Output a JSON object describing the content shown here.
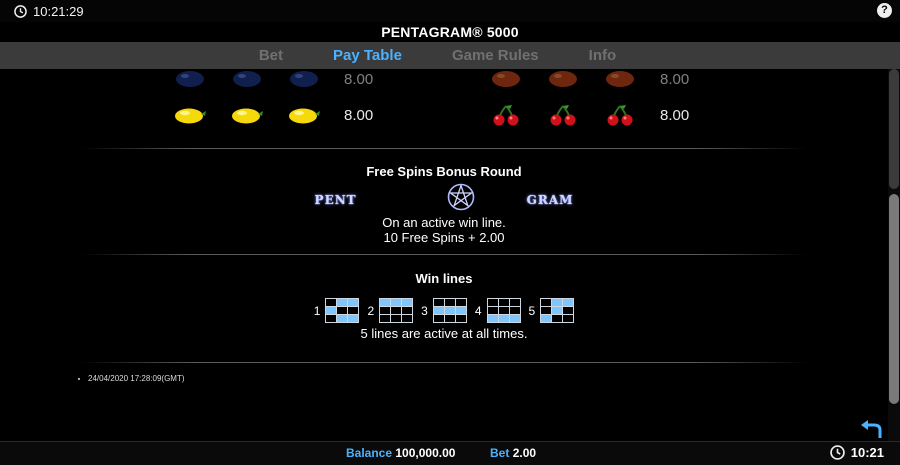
{
  "status_bar": {
    "time": "10:21:29",
    "help_label": "?"
  },
  "title": "PENTAGRAM® 5000",
  "tabs": [
    {
      "label": "Bet",
      "active": false
    },
    {
      "label": "Pay Table",
      "active": true
    },
    {
      "label": "Game Rules",
      "active": false
    },
    {
      "label": "Info",
      "active": false
    }
  ],
  "paytable": {
    "rows": [
      {
        "left_symbol": "plum-icon",
        "left_value": "8.00",
        "right_symbol": "orange-icon",
        "right_value": "8.00"
      },
      {
        "left_symbol": "lemon-icon",
        "left_value": "8.00",
        "right_symbol": "cherry-icon",
        "right_value": "8.00"
      }
    ]
  },
  "free_spins": {
    "heading": "Free Spins Bonus Round",
    "word_left": "PENT",
    "word_right": "GRAM",
    "line1": "On an active win line.",
    "line2": "10 Free Spins + 2.00"
  },
  "win_lines": {
    "heading": "Win lines",
    "lines": [
      {
        "number": "1",
        "cells": [
          0,
          1,
          1,
          1,
          0,
          0,
          0,
          1,
          1
        ]
      },
      {
        "number": "2",
        "cells": [
          1,
          1,
          1,
          0,
          0,
          0,
          0,
          0,
          0
        ]
      },
      {
        "number": "3",
        "cells": [
          0,
          0,
          0,
          1,
          1,
          1,
          0,
          0,
          0
        ]
      },
      {
        "number": "4",
        "cells": [
          0,
          0,
          0,
          0,
          0,
          0,
          1,
          1,
          1
        ]
      },
      {
        "number": "5",
        "cells": [
          0,
          1,
          1,
          0,
          1,
          0,
          1,
          0,
          0
        ]
      }
    ],
    "note": "5 lines are active at all times."
  },
  "timestamp": "24/04/2020 17:28:09(GMT)",
  "footer": {
    "balance_label": "Balance",
    "balance_value": "100,000.00",
    "bet_label": "Bet",
    "bet_value": "2.00",
    "time": "10:21"
  },
  "colors": {
    "accent": "#4cb2ff",
    "tab_bar": "#3b3b3b",
    "line_cell": "#7fc6ff"
  }
}
